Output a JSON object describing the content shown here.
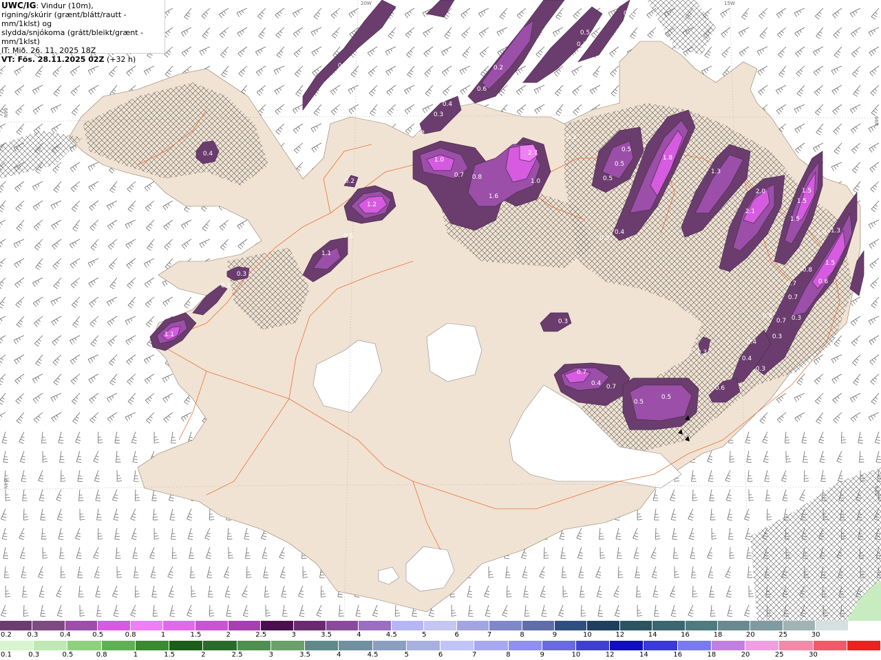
{
  "header": {
    "model": "UWC/IG",
    "line1": ": Vindur (10m),",
    "line2": "rigning/skúrir (grænt/blátt/rautt - mm/1klst) og",
    "line3": "slydda/snjókoma (grátt/bleikt/grænt - mm/1klst)",
    "it": "IT: Mið. 26. 11. 2025 18Z",
    "vt": "VT: Fös. 28.11.2025 02Z",
    "lead": "(+32 h)"
  },
  "grid_labels": {
    "lon_20w": "20W",
    "lon_15w": "15W",
    "lat_66n_left": "66N",
    "lat_66n_right": "66N",
    "lat_64n_left": "64N",
    "lat_64n_right": "64N"
  },
  "colors": {
    "land": "#f1e3d3",
    "sea": "#ffffff",
    "glacier": "#ffffff",
    "roads": "#e8703a",
    "wind_barb": "#555555",
    "precip_dark": "#6b3d6e",
    "precip_mid": "#9b4fa8",
    "precip_light": "#d65be0",
    "precip_bright": "#f07ef5"
  },
  "precip_labels": [
    {
      "v": "0.4"
    },
    {
      "v": "0.6"
    },
    {
      "v": "0.5"
    },
    {
      "v": "0.5"
    },
    {
      "v": "0.3"
    },
    {
      "v": "0.2"
    },
    {
      "v": "0.6"
    },
    {
      "v": "0.3"
    },
    {
      "v": "0.3"
    },
    {
      "v": "0.4"
    },
    {
      "v": "1.0"
    },
    {
      "v": "0.7"
    },
    {
      "v": "0.8"
    },
    {
      "v": "2.7"
    },
    {
      "v": "1.0"
    },
    {
      "v": "1.6"
    },
    {
      "v": "0.3"
    },
    {
      "v": "0.5"
    },
    {
      "v": "0.5"
    },
    {
      "v": "0.5"
    },
    {
      "v": "1.8"
    },
    {
      "v": "1.3"
    },
    {
      "v": "2.0"
    },
    {
      "v": "2.1"
    },
    {
      "v": "1.5"
    },
    {
      "v": "1.5"
    },
    {
      "v": "1.5"
    },
    {
      "v": "1.4"
    },
    {
      "v": "1.3"
    },
    {
      "v": "0.3"
    },
    {
      "v": "0.4"
    },
    {
      "v": "0.2"
    },
    {
      "v": "1.2"
    },
    {
      "v": "0.5"
    },
    {
      "v": "1.1"
    },
    {
      "v": "0.3"
    },
    {
      "v": "0.1"
    },
    {
      "v": "1.1"
    },
    {
      "v": "0.3"
    },
    {
      "v": "0.7"
    },
    {
      "v": "0.4"
    },
    {
      "v": "0.7"
    },
    {
      "v": "0.5"
    },
    {
      "v": "0.5"
    },
    {
      "v": "0.6"
    },
    {
      "v": "0.3"
    },
    {
      "v": "0.4"
    },
    {
      "v": "0.4"
    },
    {
      "v": "0.3"
    },
    {
      "v": "0.7"
    },
    {
      "v": "0.7"
    },
    {
      "v": "0.3"
    },
    {
      "v": "0.8"
    },
    {
      "v": "0.6"
    },
    {
      "v": "1.5"
    },
    {
      "v": "0.4"
    },
    {
      "v": "0.7"
    },
    {
      "v": "0.3"
    },
    {
      "v": "0.4"
    }
  ],
  "legend": {
    "snow_scale": {
      "values": [
        "0.2",
        "0.3",
        "0.4",
        "0.5",
        "0.8",
        "1",
        "1.5",
        "2",
        "2.5",
        "3",
        "3.5",
        "4",
        "4.5",
        "5",
        "6",
        "7",
        "8",
        "9",
        "10",
        "12",
        "14",
        "16",
        "18",
        "20",
        "25",
        "30"
      ],
      "colors": [
        "#6b3d6e",
        "#7e4a82",
        "#9b4fa8",
        "#d65be0",
        "#f07ef5",
        "#e06ae8",
        "#c855cf",
        "#a63fb0",
        "#4a0f4e",
        "#6a2a72",
        "#8a4c9a",
        "#9a6ec0",
        "#b6b6f6",
        "#c6c6f4",
        "#a2a6e0",
        "#7f88c8",
        "#5f6ea8",
        "#2f4f7f",
        "#1f3f5f",
        "#2a5560",
        "#3a6670",
        "#4f7a7f",
        "#6a8a90",
        "#7f9aa0",
        "#a0b4b4",
        "#d6e0e0",
        "#ffffff"
      ]
    },
    "rain_scale": {
      "values": [
        "0.1",
        "0.3",
        "0.5",
        "0.8",
        "1",
        "1.5",
        "2",
        "2.5",
        "3",
        "3.5",
        "4",
        "4.5",
        "5",
        "6",
        "7",
        "8",
        "9",
        "10",
        "12",
        "14",
        "16",
        "18",
        "20",
        "25",
        "30"
      ],
      "colors": [
        "#d8f4d0",
        "#bfe8b4",
        "#8fd080",
        "#5fb055",
        "#3a8a32",
        "#1c5e1a",
        "#2a6a2a",
        "#4f8f4f",
        "#6aa06a",
        "#608a8a",
        "#7090a0",
        "#8a9ec0",
        "#a8b0e0",
        "#c0c4f6",
        "#a8a8f0",
        "#8f8ff0",
        "#6a6ae0",
        "#4040d0",
        "#1010c0",
        "#3a3ad8",
        "#7a7af0",
        "#c080e0",
        "#f0a0e0",
        "#f08aa8",
        "#f05a6a",
        "#f02020"
      ]
    }
  }
}
